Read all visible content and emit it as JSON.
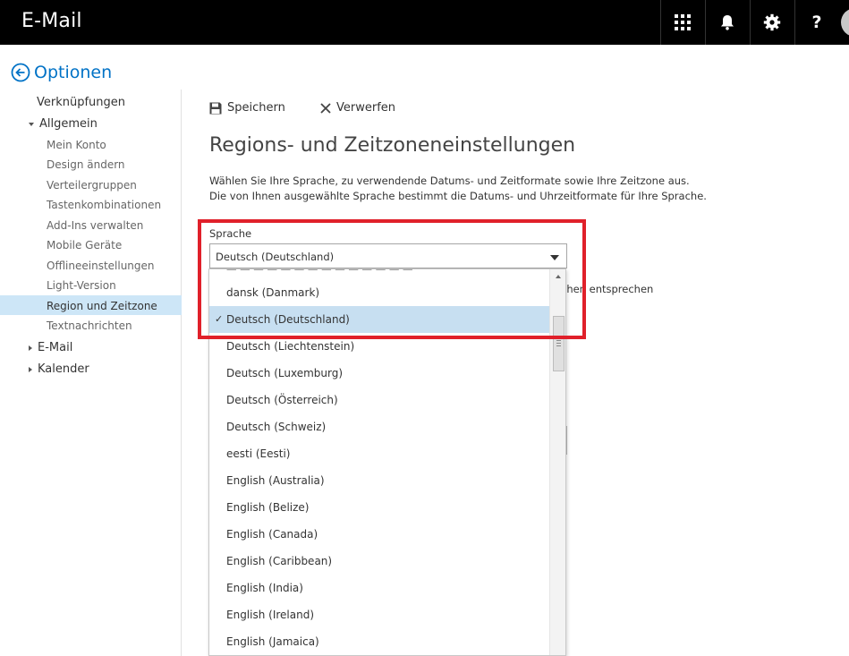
{
  "header": {
    "title": "E-Mail",
    "buttons": [
      "apps-icon",
      "bell-icon",
      "gear-icon",
      "help-icon"
    ],
    "help_label": "?"
  },
  "options": {
    "title": "Optionen"
  },
  "nav": {
    "links": "Verknüpfungen",
    "general": "Allgemein",
    "general_items": [
      "Mein Konto",
      "Design ändern",
      "Verteilergruppen",
      "Tastenkombinationen",
      "Add-Ins verwalten",
      "Mobile Geräte",
      "Offlineeinstellungen",
      "Light-Version",
      "Region und Zeitzone",
      "Textnachrichten"
    ],
    "selected": "Region und Zeitzone",
    "mail": "E-Mail",
    "calendar": "Kalender"
  },
  "toolbar": {
    "save": "Speichern",
    "discard": "Verwerfen"
  },
  "page": {
    "title": "Regions- und Zeitzoneneinstellungen",
    "desc1": "Wählen Sie Ihre Sprache, zu verwendende Datums- und Zeitformate sowie Ihre Zeitzone aus.",
    "desc2": "Die von Ihnen ausgewählte Sprache bestimmt die Datums- und Uhrzeitformate für Ihre Sprache.",
    "behind_text": "chen entsprechen"
  },
  "language": {
    "label": "Sprache",
    "value": "Deutsch (Deutschland)",
    "options": [
      "dansk (Danmark)",
      "Deutsch (Deutschland)",
      "Deutsch (Liechtenstein)",
      "Deutsch (Luxemburg)",
      "Deutsch (Österreich)",
      "Deutsch (Schweiz)",
      "eesti (Eesti)",
      "English (Australia)",
      "English (Belize)",
      "English (Canada)",
      "English (Caribbean)",
      "English (India)",
      "English (Ireland)",
      "English (Jamaica)"
    ],
    "selected": "Deutsch (Deutschland)"
  },
  "colors": {
    "accent": "#0072c6",
    "highlight": "#e0202a",
    "selected_bg": "#c7dff1",
    "nav_selected_bg": "#cde6f7"
  }
}
